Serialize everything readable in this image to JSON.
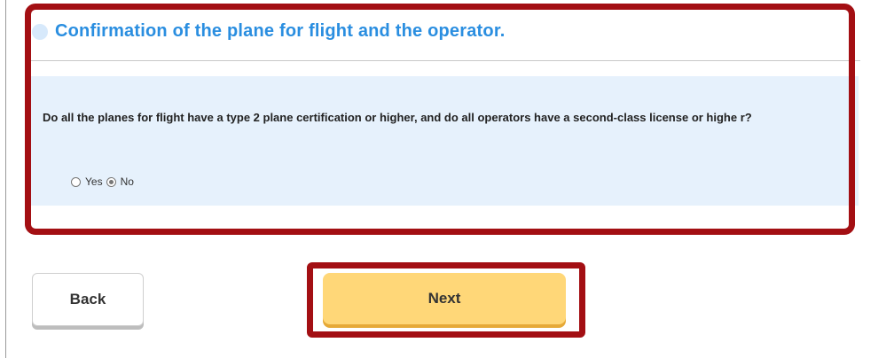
{
  "section": {
    "title": "Confirmation of the plane for flight and the operator."
  },
  "question": {
    "text": "Do all the planes for flight have a type 2 plane certification or higher, and do all operators have a second-class license or highe r?",
    "options": [
      {
        "label": "Yes",
        "checked": false
      },
      {
        "label": "No",
        "checked": true
      }
    ],
    "selected": "No"
  },
  "buttons": {
    "back_label": "Back",
    "next_label": "Next"
  },
  "colors": {
    "title_blue": "#2a8ee0",
    "panel_bg": "#e6f1fc",
    "next_bg": "#ffd778",
    "highlight_red": "#a30f13"
  }
}
